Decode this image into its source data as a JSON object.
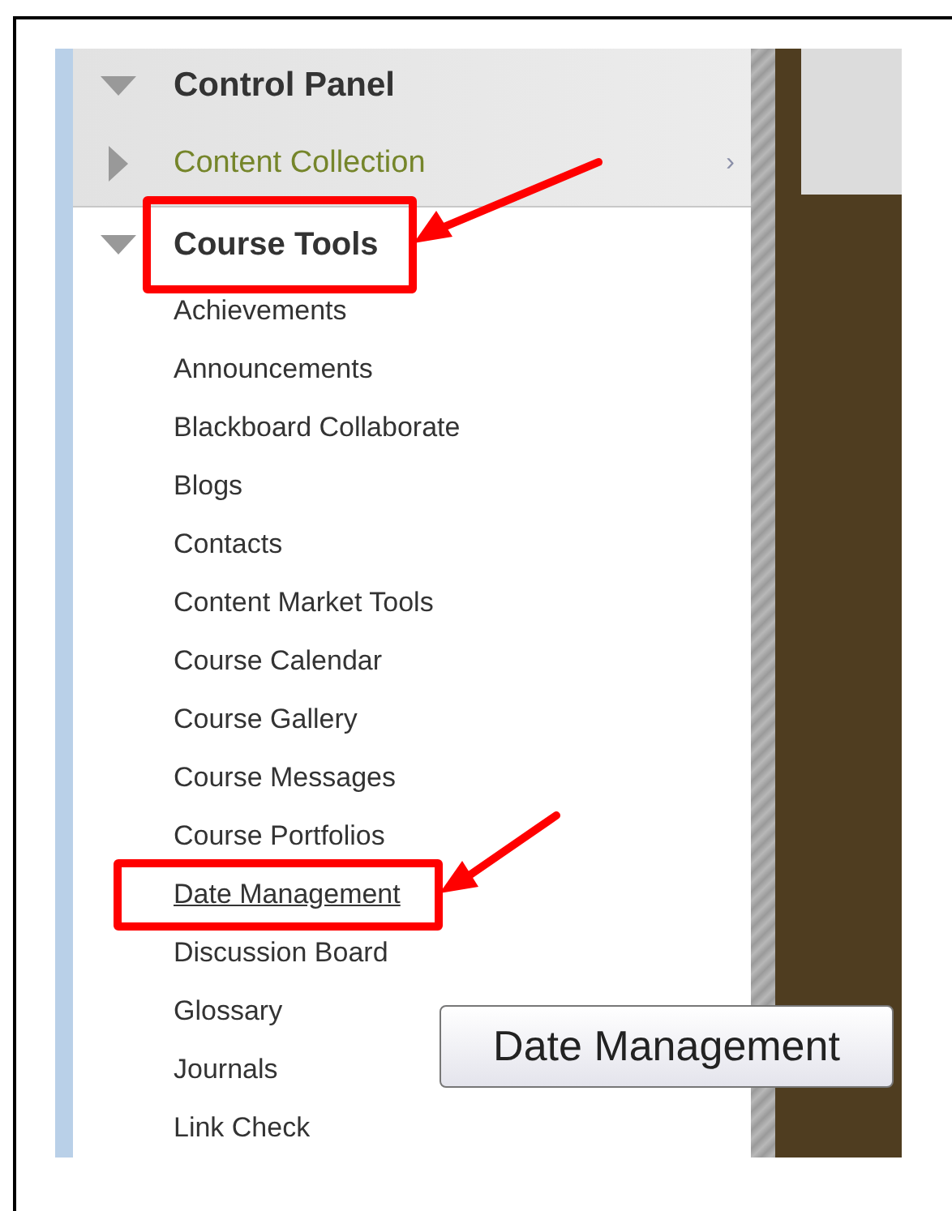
{
  "menu": {
    "control_panel": {
      "label": "Control Panel",
      "expanded": true
    },
    "content_collection": {
      "label": "Content Collection",
      "expanded": false,
      "chevron": "›"
    },
    "course_tools": {
      "label": "Course Tools",
      "expanded": true,
      "highlighted": true,
      "items": [
        {
          "label": "Achievements",
          "hovered": false,
          "highlighted": false
        },
        {
          "label": "Announcements",
          "hovered": false,
          "highlighted": false
        },
        {
          "label": "Blackboard Collaborate",
          "hovered": false,
          "highlighted": false
        },
        {
          "label": "Blogs",
          "hovered": false,
          "highlighted": false
        },
        {
          "label": "Contacts",
          "hovered": false,
          "highlighted": false
        },
        {
          "label": "Content Market Tools",
          "hovered": false,
          "highlighted": false
        },
        {
          "label": "Course Calendar",
          "hovered": false,
          "highlighted": false
        },
        {
          "label": "Course Gallery",
          "hovered": false,
          "highlighted": false
        },
        {
          "label": "Course Messages",
          "hovered": false,
          "highlighted": false
        },
        {
          "label": "Course Portfolios",
          "hovered": false,
          "highlighted": false
        },
        {
          "label": "Date Management",
          "hovered": true,
          "highlighted": true
        },
        {
          "label": "Discussion Board",
          "hovered": false,
          "highlighted": false
        },
        {
          "label": "Glossary",
          "hovered": false,
          "highlighted": false
        },
        {
          "label": "Journals",
          "hovered": false,
          "highlighted": false
        },
        {
          "label": "Link Check",
          "hovered": false,
          "highlighted": false
        }
      ]
    }
  },
  "tooltip": {
    "text": "Date Management"
  }
}
